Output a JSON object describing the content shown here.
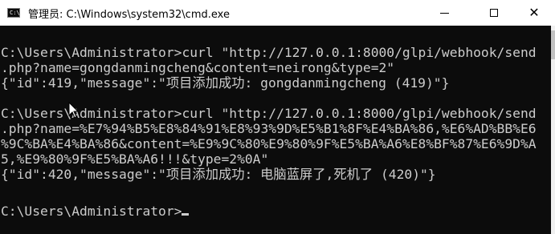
{
  "window": {
    "title": "管理员: C:\\Windows\\system32\\cmd.exe",
    "icon": "cmd-icon",
    "icon_prompt": "C:\\",
    "minimize_label": "",
    "close_glyph": "✕"
  },
  "console": {
    "lines": [
      "C:\\Users\\Administrator>curl \"http://127.0.0.1:8000/glpi/webhook/send",
      ".php?name=gongdanmingcheng&content=neirong&type=2\"",
      "{\"id\":419,\"message\":\"项目添加成功: gongdanmingcheng (419)\"}",
      "",
      "C:\\Users\\Administrator>curl \"http://127.0.0.1:8000/glpi/webhook/send",
      ".php?name=%E7%94%B5%E8%84%91%E8%93%9D%E5%B1%8F%E4%BA%86,%E6%AD%BB%E6",
      "%9C%BA%E4%BA%86&content=%E9%9C%80%E9%80%9F%E5%BA%A6%E8%BF%87%E6%9D%A",
      "5,%E9%80%9F%E5%BA%A6!!!&type=2%0A\"",
      "{\"id\":420,\"message\":\"项目添加成功: 电脑蓝屏了,死机了 (420)\"}",
      "",
      "C:\\Users\\Administrator>"
    ]
  },
  "colors": {
    "console_bg": "#0c0c0c",
    "console_fg": "#cccccc",
    "titlebar_bg": "#ffffff"
  }
}
